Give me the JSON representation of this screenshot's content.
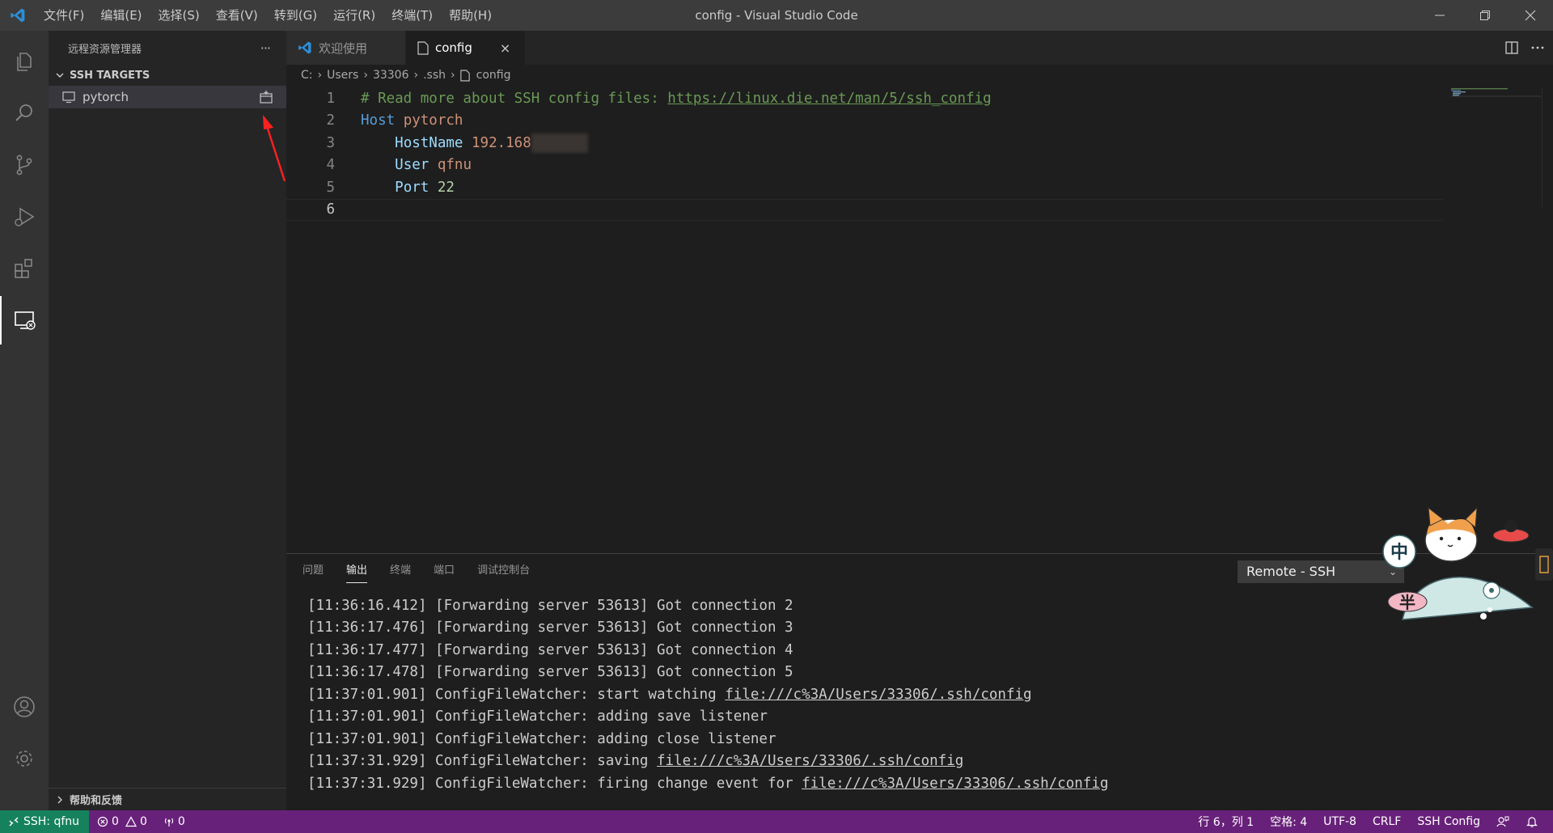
{
  "window": {
    "title": "config - Visual Studio Code",
    "menu": [
      "文件(F)",
      "编辑(E)",
      "选择(S)",
      "查看(V)",
      "转到(G)",
      "运行(R)",
      "终端(T)",
      "帮助(H)"
    ]
  },
  "activity_bar": {
    "items": [
      "explorer-icon",
      "search-icon",
      "source-control-icon",
      "run-debug-icon",
      "extensions-icon",
      "remote-explorer-icon"
    ],
    "bottom": [
      "account-icon",
      "settings-gear-icon"
    ]
  },
  "sidebar": {
    "title": "远程资源管理器",
    "more": "···",
    "section": "SSH TARGETS",
    "targets": [
      {
        "label": "pytorch"
      }
    ],
    "footer": "帮助和反馈"
  },
  "tabs": [
    {
      "label": "欢迎使用",
      "active": false
    },
    {
      "label": "config",
      "active": true,
      "close": "×"
    }
  ],
  "breadcrumb": [
    "C:",
    "Users",
    "33306",
    ".ssh",
    "config"
  ],
  "editor": {
    "lines": [
      {
        "n": "1",
        "comment": "# Read more about SSH config files: ",
        "link": "https://linux.die.net/man/5/ssh_config"
      },
      {
        "n": "2",
        "kw": "Host",
        "val": "pytorch"
      },
      {
        "n": "3",
        "key": "HostName",
        "val": "192.168"
      },
      {
        "n": "4",
        "key": "User",
        "val": "qfnu"
      },
      {
        "n": "5",
        "key": "Port",
        "val": "22"
      },
      {
        "n": "6"
      }
    ]
  },
  "panel": {
    "tabs": [
      "问题",
      "输出",
      "终端",
      "端口",
      "调试控制台"
    ],
    "active_tab": "输出",
    "channel": "Remote - SSH",
    "output": [
      {
        "text": "[11:36:16.412] [Forwarding server 53613] Got connection 2"
      },
      {
        "text": "[11:36:17.476] [Forwarding server 53613] Got connection 3"
      },
      {
        "text": "[11:36:17.477] [Forwarding server 53613] Got connection 4"
      },
      {
        "text": "[11:36:17.478] [Forwarding server 53613] Got connection 5"
      },
      {
        "text": "[11:37:01.901] ConfigFileWatcher: start watching ",
        "link": "file:///c%3A/Users/33306/.ssh/config"
      },
      {
        "text": "[11:37:01.901] ConfigFileWatcher: adding save listener"
      },
      {
        "text": "[11:37:01.901] ConfigFileWatcher: adding close listener"
      },
      {
        "text": "[11:37:31.929] ConfigFileWatcher: saving ",
        "link": "file:///c%3A/Users/33306/.ssh/config"
      },
      {
        "text": "[11:37:31.929] ConfigFileWatcher: firing change event for ",
        "link": "file:///c%3A/Users/33306/.ssh/config"
      }
    ]
  },
  "mascot": {
    "badge_top": "中",
    "badge_bottom": "半"
  },
  "statusbar": {
    "remote": "SSH: qfnu",
    "errors": "0",
    "warnings": "0",
    "ports": "0",
    "position": "行 6，列 1",
    "spaces": "空格: 4",
    "encoding": "UTF-8",
    "eol": "CRLF",
    "language": "SSH Config"
  },
  "colors": {
    "statusbar": "#68217a",
    "remote_indicator": "#16825d",
    "comment": "#6a9955",
    "keyword": "#569cd6",
    "key": "#9cdcfe",
    "string": "#ce9178",
    "number": "#b5cea8",
    "annotation_arrow": "#ff2020"
  }
}
